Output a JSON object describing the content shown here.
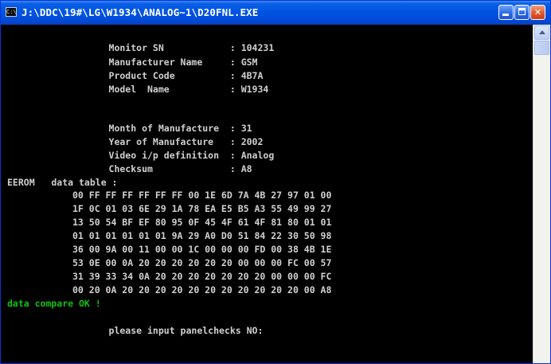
{
  "window": {
    "icon_label": "C:\\",
    "title": "J:\\DDC\\19#\\LG\\W1934\\ANALOG~1\\D20FNL.EXE"
  },
  "console": {
    "monitor_sn": "      Monitor SN            : 104231",
    "manufacturer_name": "      Manufacturer Name     : GSM",
    "product_code": "      Product Code          : 4B7A",
    "model_name": "      Model  Name           : W1934",
    "month_of_manufacture": "      Month of Manufacture  : 31",
    "year_of_manufacture": "      Year of Manufacture   : 2002",
    "video_ip_definition": "      Video i/p definition  : Analog",
    "checksum": "      Checksum              : A8",
    "eerom_header": "EEROM   data table :",
    "hex_rows": [
      "00 FF FF FF FF FF FF 00 1E 6D 7A 4B 27 97 01 00",
      "1F 0C 01 03 6E 29 1A 78 EA E5 B5 A3 55 49 99 27",
      "13 50 54 BF EF 80 95 0F 45 4F 61 4F 81 80 01 01",
      "01 01 01 01 01 01 9A 29 A0 D0 51 84 22 30 50 98",
      "36 00 9A 00 11 00 00 1C 00 00 00 FD 00 38 4B 1E",
      "53 0E 00 0A 20 20 20 20 20 20 00 00 00 FC 00 57",
      "31 39 33 34 0A 20 20 20 20 20 20 20 00 00 00 FC",
      "00 20 0A 20 20 20 20 20 20 20 20 20 20 20 00 A8"
    ],
    "compare_status": "data compare OK !",
    "prompt": "      please input panelchecks NO:"
  },
  "colors": {
    "console_text": "#d0d0d0",
    "status_green": "#10c010",
    "titlebar_blue": "#0054e3"
  }
}
